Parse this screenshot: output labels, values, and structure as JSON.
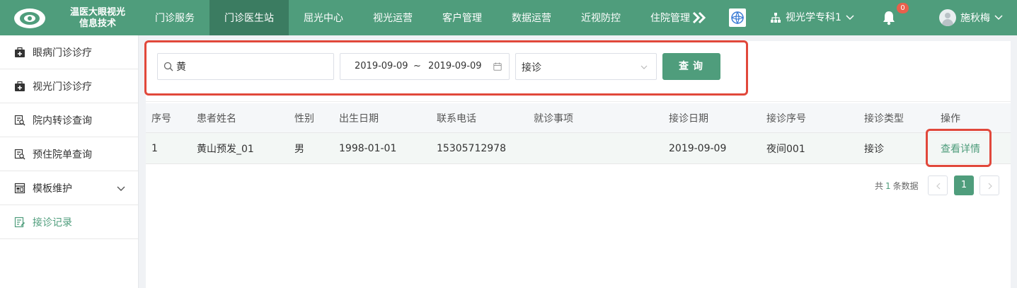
{
  "header": {
    "logo_line1": "温医大眼视光",
    "logo_line2": "信息技术",
    "nav": [
      "门诊服务",
      "门诊医生站",
      "屈光中心",
      "视光运营",
      "客户管理",
      "数据运营",
      "近视防控",
      "住院管理"
    ],
    "active_nav": "门诊医生站",
    "department": "视光学专科1",
    "notification_count": "0",
    "user_name": "施秋梅"
  },
  "sidebar": {
    "items": [
      {
        "label": "眼病门诊诊疗",
        "icon": "medical-kit-icon"
      },
      {
        "label": "视光门诊诊疗",
        "icon": "medical-kit-icon"
      },
      {
        "label": "院内转诊查询",
        "icon": "document-search-icon"
      },
      {
        "label": "预住院单查询",
        "icon": "document-search-icon"
      },
      {
        "label": "模板维护",
        "icon": "template-icon"
      },
      {
        "label": "接诊记录",
        "icon": "edit-note-icon"
      }
    ],
    "active": "接诊记录"
  },
  "search": {
    "keyword": "黄",
    "date_start": "2019-09-09",
    "date_separator": "~",
    "date_end": "2019-09-09",
    "type": "接诊",
    "query_label": "查询"
  },
  "table": {
    "columns": [
      "序号",
      "患者姓名",
      "性别",
      "出生日期",
      "联系电话",
      "就诊事项",
      "接诊日期",
      "接诊序号",
      "接诊类型",
      "操作"
    ],
    "rows": [
      {
        "index": "1",
        "name": "黄山预发_01",
        "gender": "男",
        "birth_date": "1998-01-01",
        "phone": "15305712978",
        "item": "",
        "visit_date": "2019-09-09",
        "visit_no": "夜间001",
        "visit_type": "接诊",
        "action": "查看详情"
      }
    ]
  },
  "pagination": {
    "total_prefix": "共",
    "total": "1",
    "total_suffix": "条数据",
    "current_page": "1"
  },
  "colors": {
    "brand": "#4f9d7c",
    "highlight": "#e1483b"
  }
}
